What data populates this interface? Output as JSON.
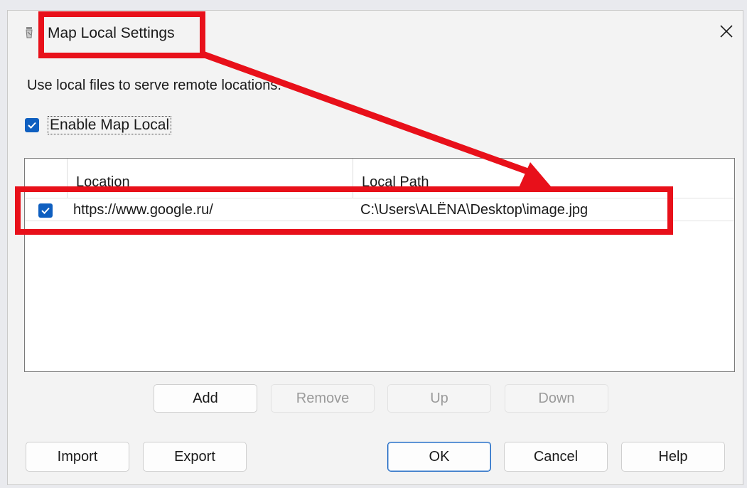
{
  "window": {
    "title": "Map Local Settings",
    "close_glyph": "✕",
    "icon": "charles-jar-icon"
  },
  "description": "Use local files to serve remote locations.",
  "enable_checkbox": {
    "label": "Enable Map Local",
    "checked": true
  },
  "table": {
    "columns": [
      "Location",
      "Local Path"
    ],
    "rows": [
      {
        "enabled": true,
        "location": "https://www.google.ru/",
        "local_path": "C:\\Users\\ALËNA\\Desktop\\image.jpg"
      }
    ]
  },
  "list_buttons": {
    "add": "Add",
    "remove": "Remove",
    "up": "Up",
    "down": "Down"
  },
  "footer_buttons": {
    "import": "Import",
    "export": "Export",
    "ok": "OK",
    "cancel": "Cancel",
    "help": "Help"
  },
  "colors": {
    "accent": "#0f5fc0",
    "annotation": "#e8101a"
  }
}
